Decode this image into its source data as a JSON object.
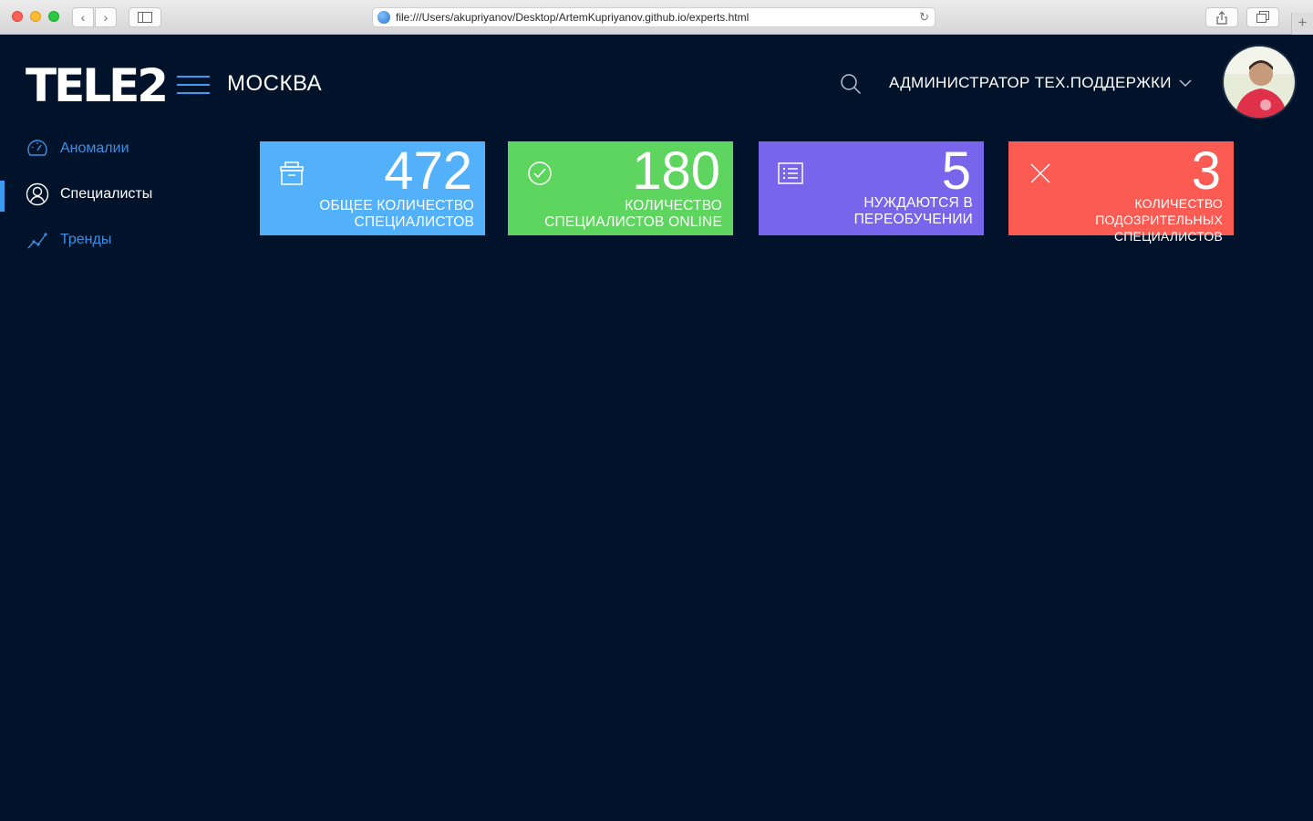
{
  "browser": {
    "url": "file:///Users/akupriyanov/Desktop/ArtemKupriyanov.github.io/experts.html",
    "back_glyph": "‹",
    "forward_glyph": "›",
    "reload_glyph": "↻",
    "newtab_glyph": "+"
  },
  "header": {
    "logo_text": "TELE2",
    "city": "МОСКВА",
    "user_role": "АДМИНИСТРАТОР ТЕХ.ПОДДЕРЖКИ"
  },
  "sidebar": {
    "items": [
      {
        "label": "Аномалии",
        "icon": "speedometer-icon",
        "active": false
      },
      {
        "label": "Специалисты",
        "icon": "user-icon",
        "active": true
      },
      {
        "label": "Тренды",
        "icon": "trend-chart-icon",
        "active": false
      }
    ]
  },
  "cards": [
    {
      "value": "472",
      "caption_line1": "ОБЩЕЕ КОЛИЧЕСТВО",
      "caption_line2": "СПЕЦИАЛИСТОВ",
      "icon": "archive-box-icon",
      "color": "#53b0fa"
    },
    {
      "value": "180",
      "caption_line1": "КОЛИЧЕСТВО",
      "caption_line2": "СПЕЦИАЛИСТОВ ONLINE",
      "icon": "clock-check-icon",
      "color": "#5ed55f"
    },
    {
      "value": "5",
      "caption_line1": "НУЖДАЮТСЯ В",
      "caption_line2": "ПЕРЕОБУЧЕНИИ",
      "icon": "list-icon",
      "color": "#7965ec"
    },
    {
      "value": "3",
      "caption_line1": "КОЛИЧЕСТВО ПОДОЗРИТЕЛЬНЫХ",
      "caption_line2": "СПЕЦИАЛИСТОВ",
      "icon": "close-x-icon",
      "color": "#fb5b52"
    }
  ],
  "colors": {
    "background": "#01132a",
    "accent": "#3b9cf0"
  }
}
